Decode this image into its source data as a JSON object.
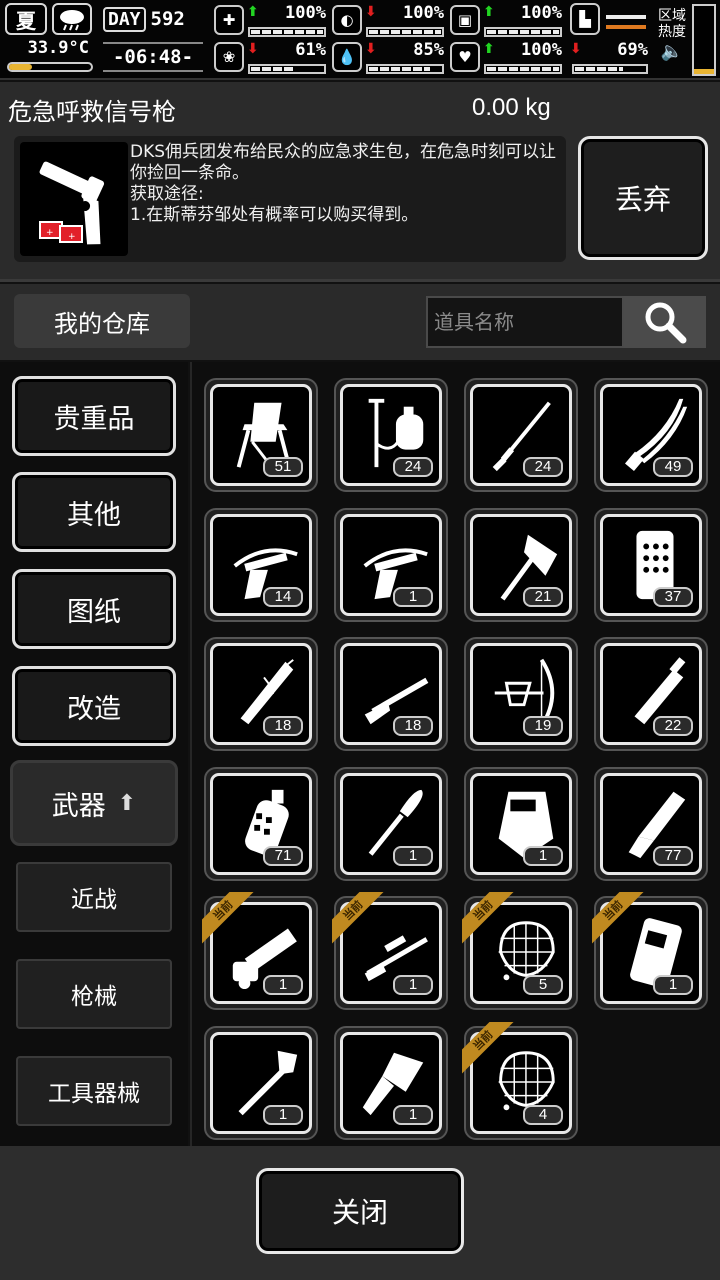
{
  "status": {
    "season": "夏",
    "weather_icon": "rain-cloud-icon",
    "temperature": "33.9°C",
    "temperature_level": 0.28,
    "day_label": "DAY",
    "day_number": "592",
    "time": "-06:48-",
    "stats": [
      {
        "icon": "medical-kit-icon",
        "trend": "up",
        "value": "100%",
        "level": 1.0
      },
      {
        "icon": "stomach-icon",
        "trend": "down",
        "value": "100%",
        "level": 1.0
      },
      {
        "icon": "bottle-icon",
        "trend": "up",
        "value": "100%",
        "level": 1.0
      },
      {
        "icon": "brain-icon",
        "trend": "down",
        "value": "61%",
        "level": 0.61
      },
      {
        "icon": "water-drop-icon",
        "trend": "down",
        "value": "85%",
        "level": 0.85
      },
      {
        "icon": "heart-icon",
        "trend": "up",
        "value": "100%",
        "level": 1.0
      }
    ],
    "stamina": {
      "icon": "boot-icon",
      "trend": "down",
      "value": "69%"
    },
    "region_label": "区域\n热度",
    "region_heat_level": 0.08,
    "accent_colors": {
      "up": "#22d422",
      "down": "#e21f1f",
      "orange": "#e07a20",
      "gold": "#c08a20"
    }
  },
  "detail": {
    "name": "危急呼救信号枪",
    "weight": "0.00 kg",
    "icon": "flare-gun-icon",
    "description": "DKS佣兵团发布给民众的应急求生包，在危急时刻可以让你捡回一条命。\n获取途径:\n1.在斯蒂芬邹处有概率可以购买得到。",
    "discard_label": "丢弃"
  },
  "storage": {
    "title": "我的仓库",
    "search_placeholder": "道具名称",
    "search_icon": "magnifier-icon"
  },
  "categories": [
    {
      "label": "贵重品"
    },
    {
      "label": "其他"
    },
    {
      "label": "图纸"
    },
    {
      "label": "改造"
    },
    {
      "label": "武器",
      "active": true,
      "arrow": "⬆"
    }
  ],
  "subcategories": [
    {
      "label": "近战"
    },
    {
      "label": "枪械"
    },
    {
      "label": "工具器械"
    }
  ],
  "equipped_tag": "当前",
  "items": [
    {
      "icon": "folding-chair-icon",
      "count": "51"
    },
    {
      "icon": "pressure-sprayer-icon",
      "count": "24"
    },
    {
      "icon": "thin-sword-icon",
      "count": "24"
    },
    {
      "icon": "katana-icon",
      "count": "49"
    },
    {
      "icon": "crossbow-icon",
      "count": "14"
    },
    {
      "icon": "crossbow-icon",
      "count": "1"
    },
    {
      "icon": "axe-icon",
      "count": "21"
    },
    {
      "icon": "riot-board-icon",
      "count": "37"
    },
    {
      "icon": "spiked-bat-icon",
      "count": "18"
    },
    {
      "icon": "rifle-icon",
      "count": "18"
    },
    {
      "icon": "compound-bow-icon",
      "count": "19"
    },
    {
      "icon": "broadsword-icon",
      "count": "22"
    },
    {
      "icon": "grenade-icon",
      "count": "71"
    },
    {
      "icon": "scalpel-icon",
      "count": "1"
    },
    {
      "icon": "riot-shield-icon",
      "count": "1"
    },
    {
      "icon": "machete-icon",
      "count": "77"
    },
    {
      "icon": "minigun-icon",
      "count": "1",
      "equipped": true
    },
    {
      "icon": "sniper-rifle-icon",
      "count": "1",
      "equipped": true
    },
    {
      "icon": "net-icon",
      "count": "5",
      "equipped": true
    },
    {
      "icon": "armor-plate-icon",
      "count": "1",
      "equipped": true
    },
    {
      "icon": "shovel-icon",
      "count": "1"
    },
    {
      "icon": "cleaver-icon",
      "count": "1"
    },
    {
      "icon": "net-icon",
      "count": "4",
      "equipped": true
    }
  ],
  "close_label": "关闭"
}
